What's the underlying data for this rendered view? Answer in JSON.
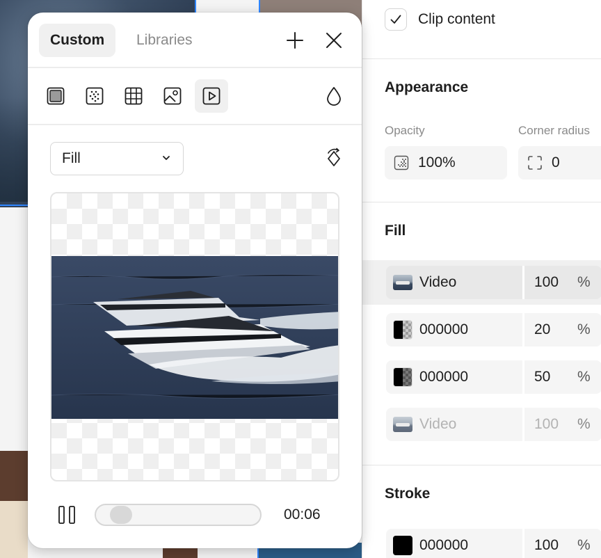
{
  "layers_panel": {
    "clip_content": {
      "label": "Clip content",
      "checked": true
    },
    "appearance": {
      "title": "Appearance",
      "opacity": {
        "label": "Opacity",
        "value": "100%"
      },
      "corner_radius": {
        "label": "Corner radius",
        "value": "0"
      }
    },
    "fill": {
      "title": "Fill",
      "rows": [
        {
          "name": "Video",
          "percent": "100",
          "symbol": "%",
          "swatch": "video-thumbnail",
          "selected": true
        },
        {
          "name": "000000",
          "percent": "20",
          "symbol": "%",
          "swatch": "color-alpha",
          "color": "#000000"
        },
        {
          "name": "000000",
          "percent": "50",
          "symbol": "%",
          "swatch": "color-alpha",
          "color": "#000000"
        },
        {
          "name": "Video",
          "percent": "100",
          "symbol": "%",
          "swatch": "video-thumbnail",
          "dimmed": true
        }
      ]
    },
    "stroke": {
      "title": "Stroke",
      "row": {
        "name": "000000",
        "percent": "100",
        "symbol": "%",
        "color": "#000000"
      }
    }
  },
  "fill_popover": {
    "tabs": [
      {
        "label": "Custom",
        "active": true
      },
      {
        "label": "Libraries",
        "active": false
      }
    ],
    "header_icons": [
      "plus-icon",
      "close-icon"
    ],
    "fill_types": [
      "solid-fill-icon",
      "gradient-fill-icon",
      "pattern-fill-icon",
      "image-fill-icon",
      "video-fill-icon"
    ],
    "active_fill_type": "video-fill-icon",
    "blend_icon": "drop-icon",
    "scale_mode": {
      "selected": "Fill"
    },
    "preview": {
      "content": "video-frame",
      "subject": "two yachts at sea"
    },
    "playback": {
      "state": "playing",
      "time": "00:06",
      "progress": 0.05
    }
  },
  "colors": {
    "accent": "#2f86ff",
    "text": "#1e1e1e",
    "muted": "#8a8a8a",
    "field_bg": "#f5f5f5"
  }
}
